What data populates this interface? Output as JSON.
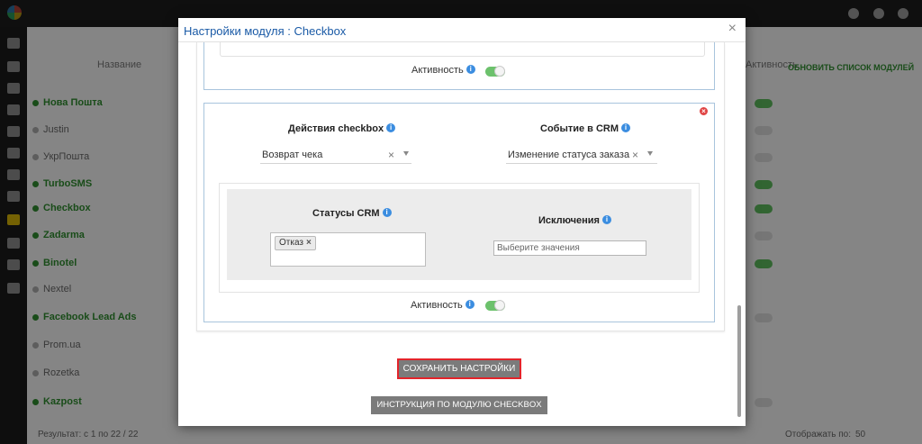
{
  "modal": {
    "title": "Настройки модуля : Checkbox",
    "close_label": "×"
  },
  "block_top": {
    "activity_label": "Активность",
    "activity_enabled": true
  },
  "block_main": {
    "remove_label": "×",
    "checkbox_action": {
      "label": "Действия checkbox",
      "selected": "Возврат чека"
    },
    "crm_event": {
      "label": "Событие в CRM",
      "selected": "Изменение статуса заказа"
    },
    "crm_statuses": {
      "label": "Статусы CRM",
      "tags": [
        "Отказ"
      ],
      "tag_remove": "×"
    },
    "exclusions": {
      "label": "Исключения",
      "placeholder": "Выберите значения"
    },
    "activity_label": "Активность",
    "activity_enabled": true
  },
  "buttons": {
    "save": "СОХРАНИТЬ НАСТРОЙКИ",
    "instruction": "ИНСТРУКЦИЯ ПО МОДУЛЮ CHECKBOX"
  },
  "info_glyph": "i",
  "colors": {
    "title": "#1a5aa6",
    "toggle_on": "#6cc16c",
    "save_border": "#e3242b",
    "button_bg": "#7b7b7b",
    "block_border": "#a8c4dd"
  },
  "background": {
    "column_name": "Название",
    "column_activity": "Активность",
    "refresh_link": "ОБНОВИТЬ СПИСОК МОДУЛЕЙ",
    "modules": [
      {
        "name": "Нова Пошта",
        "active": true
      },
      {
        "name": "Justin",
        "active": false
      },
      {
        "name": "УкрПошта",
        "active": false
      },
      {
        "name": "TurboSMS",
        "active": true
      },
      {
        "name": "Checkbox",
        "active": true
      },
      {
        "name": "Zadarma",
        "active": true
      },
      {
        "name": "Binotel",
        "active": true
      },
      {
        "name": "Nextel",
        "active": false
      },
      {
        "name": "Facebook Lead Ads",
        "active": true
      },
      {
        "name": "Prom.ua",
        "active": false
      },
      {
        "name": "Rozetka",
        "active": false
      },
      {
        "name": "Kazpost",
        "active": true
      }
    ],
    "result_text": "Результат: с 1 по 22 / 22",
    "per_page_label": "Отображать по:",
    "per_page_value": "50"
  }
}
